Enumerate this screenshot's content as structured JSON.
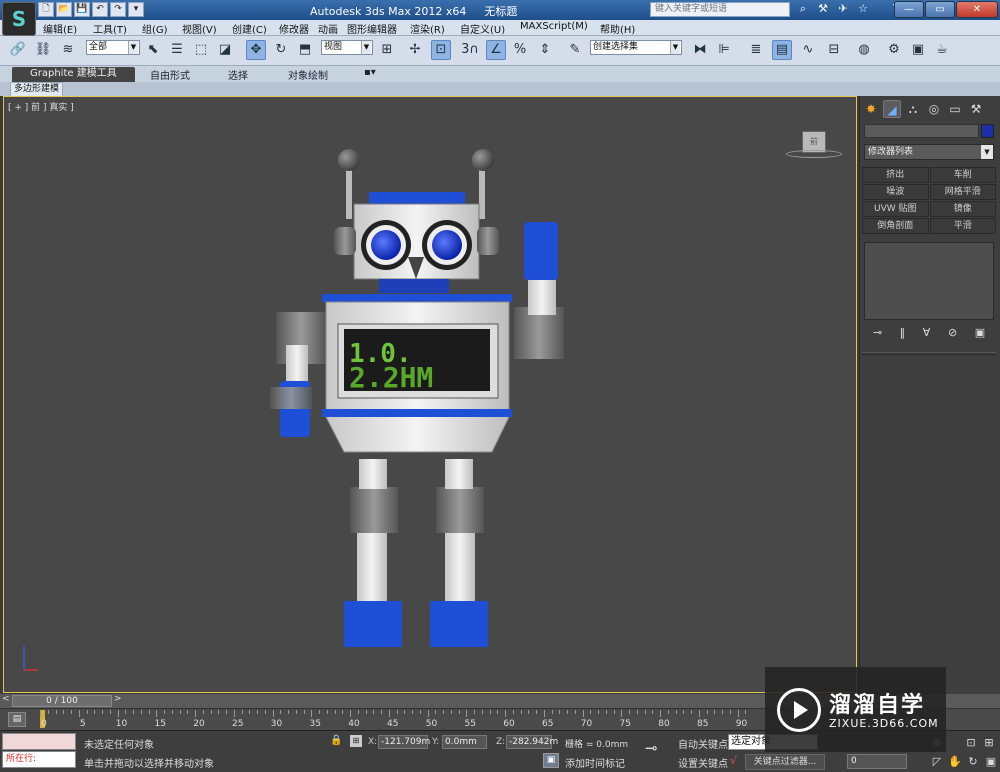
{
  "titlebar": {
    "app_title": "Autodesk 3ds Max  2012 x64",
    "file_name": "无标题",
    "search_placeholder": "键入关键字或短语",
    "win_minimize": "—",
    "win_maximize": "▭",
    "win_close": "✕"
  },
  "quick_access": [
    "🗋",
    "📂",
    "💾",
    "↶",
    "↷",
    "▾"
  ],
  "menu": [
    "编辑(E)",
    "工具(T)",
    "组(G)",
    "视图(V)",
    "创建(C)",
    "修改器",
    "动画",
    "图形编辑器",
    "渲染(R)",
    "自定义(U)",
    "MAXScript(M)",
    "帮助(H)"
  ],
  "toolbar": {
    "selection_filter": "全部",
    "ref_coord": "视图",
    "named_selection": "创建选择集",
    "snap_number": "3"
  },
  "ribbon": {
    "tabs": [
      "Graphite 建模工具",
      "自由形式",
      "选择",
      "对象绘制"
    ],
    "active_tab": "Graphite 建模工具",
    "sub_label": "多边形建模"
  },
  "viewport": {
    "label": "[ + ] 前 ] 真实 ]",
    "viewcube_face": "前",
    "screen_text_line1": "1.0.",
    "screen_text_line2": "2.2HM"
  },
  "command_panel": {
    "modifier_list": "修改器列表",
    "modifier_buttons": [
      "挤出",
      "车削",
      "噪波",
      "网格平滑",
      "UVW 贴图",
      "镜像",
      "倒角剖面",
      "平滑"
    ],
    "swatch_color": "#1a2fa8"
  },
  "timeline": {
    "slider_text": "0 / 100",
    "ticks": [
      0,
      5,
      10,
      15,
      20,
      25,
      30,
      35,
      40,
      45,
      50,
      55,
      60,
      65,
      70,
      75,
      80,
      85,
      90
    ]
  },
  "status": {
    "running_label": "所在行:",
    "line1": "未选定任何对象",
    "line2": "单击并拖动以选择并移动对象",
    "x_label": "X:",
    "x_value": "-121.709m",
    "y_label": "Y:",
    "y_value": "0.0mm",
    "z_label": "Z:",
    "z_value": "-282.942m",
    "grid": "栅格 = 0.0mm",
    "add_time_tag": "添加时间标记",
    "auto_key": "自动关键点",
    "set_key": "设置关键点",
    "selected_object": "选定对象",
    "key_filters": "关键点过滤器...",
    "frame": "0"
  },
  "watermark": {
    "title": "溜溜自学",
    "url": "ZIXUE.3D66.COM"
  }
}
